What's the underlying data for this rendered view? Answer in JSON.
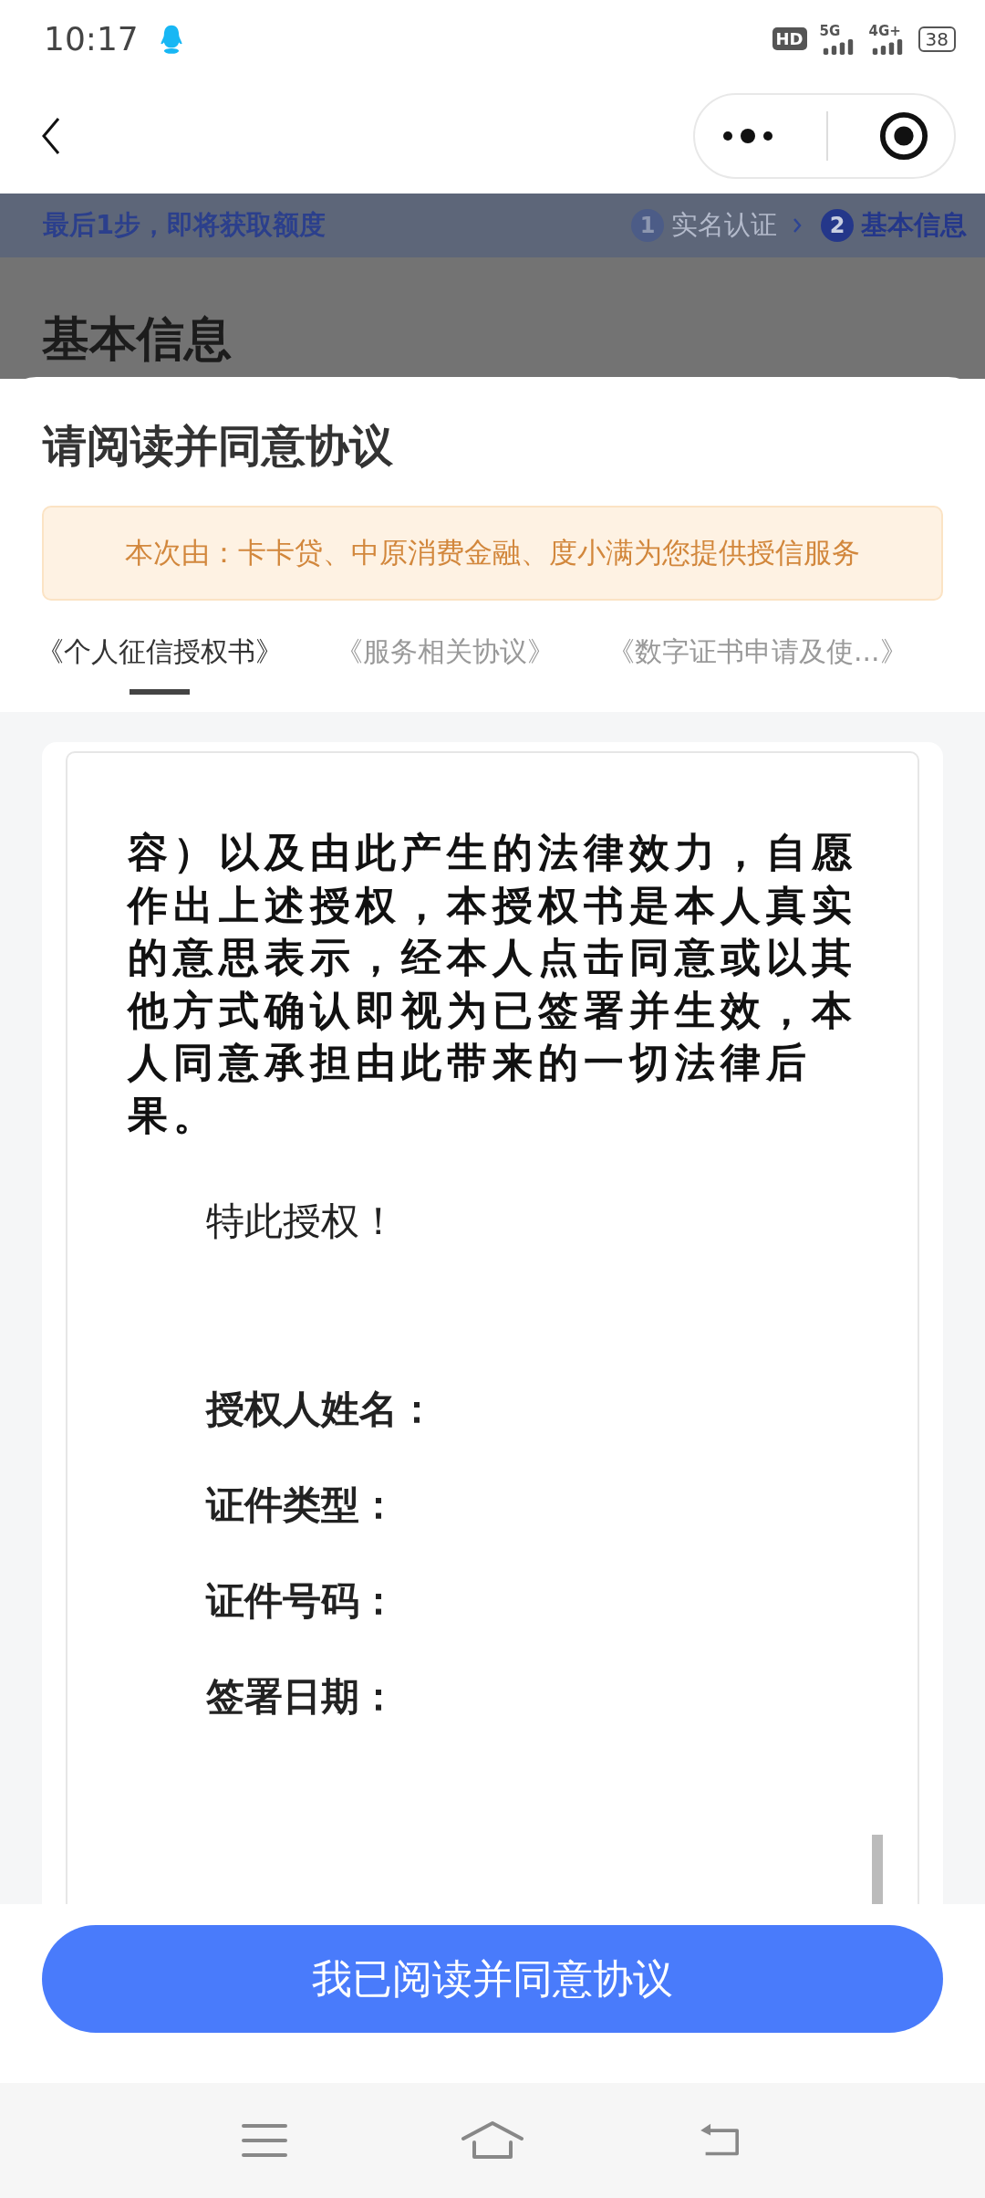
{
  "status_bar": {
    "time": "10:17",
    "hd": "HD",
    "networks": [
      {
        "label": "5G"
      },
      {
        "label": "4G+"
      }
    ],
    "battery": "38"
  },
  "progress": {
    "hint": "最后1步，即将获取额度",
    "steps": [
      {
        "number": "1",
        "label": "实名认证",
        "selected": false
      },
      {
        "number": "2",
        "label": "基本信息",
        "selected": true
      }
    ]
  },
  "page_heading": "基本信息",
  "sheet": {
    "title": "请阅读并同意协议",
    "notice": "本次由：卡卡贷、中原消费金融、度小满为您提供授信服务",
    "tabs": [
      {
        "label": "《个人征信授权书》",
        "selected": true
      },
      {
        "label": "《服务相关协议》",
        "selected": false
      },
      {
        "label": "《数字证书申请及使...》",
        "selected": false
      }
    ],
    "document": {
      "paragraph": "容）以及由此产生的法律效力，自愿作出上述授权，本授权书是本人真实的意思表示，经本人点击同意或以其他方式确认即视为已签署并生效，本人同意承担由此带来的一切法律后果。",
      "closing": "特此授权！",
      "fields": [
        {
          "label": "授权人姓名："
        },
        {
          "label": "证件类型："
        },
        {
          "label": "证件号码："
        },
        {
          "label": "签署日期："
        }
      ]
    },
    "agree_button": "我已阅读并同意协议"
  }
}
